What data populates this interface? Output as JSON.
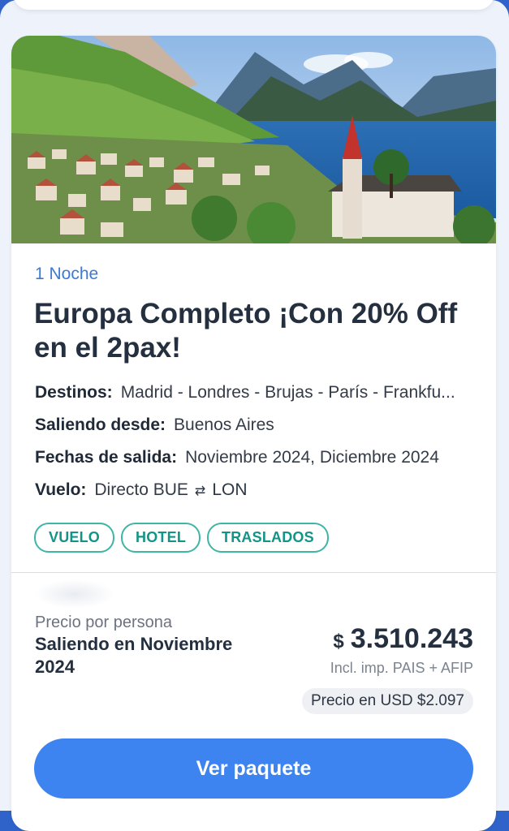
{
  "package": {
    "nights": "1 Noche",
    "title": "Europa Completo ¡Con 20% Off en el 2pax!",
    "destinos_label": "Destinos:",
    "destinos_value": "Madrid - Londres - Brujas - París - Frankfu...",
    "saliendo_label": "Saliendo desde:",
    "saliendo_value": "Buenos Aires",
    "fechas_label": "Fechas de salida:",
    "fechas_value": "Noviembre 2024, Diciembre 2024",
    "vuelo_label": "Vuelo:",
    "vuelo_from": "Directo BUE",
    "vuelo_to": "LON",
    "tags": [
      "VUELO",
      "HOTEL",
      "TRASLADOS"
    ]
  },
  "pricing": {
    "label": "Precio por persona",
    "departure": "Saliendo en Noviembre 2024",
    "currency": "$",
    "amount": "3.510.243",
    "taxes": "Incl. imp. PAIS + AFIP",
    "usd": "Precio en USD $2.097"
  },
  "cta": {
    "label": "Ver paquete"
  },
  "colors": {
    "accent": "#3d84f0",
    "tag": "#3fb5a6",
    "nights": "#3c7ad4"
  },
  "icons": {
    "flight_direction": "swap-arrows-icon"
  }
}
